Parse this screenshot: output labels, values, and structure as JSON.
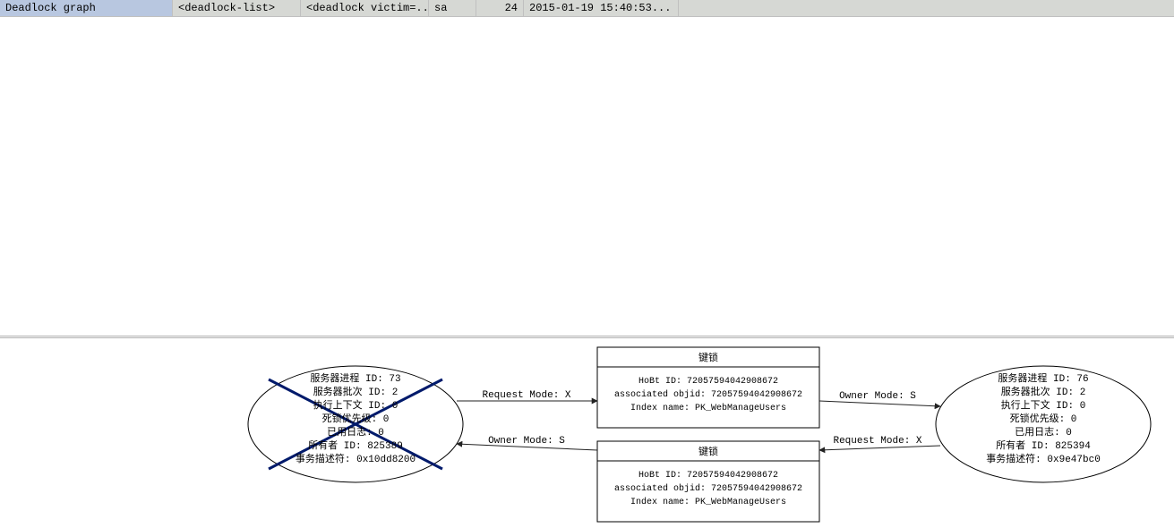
{
  "row": {
    "event_class": "Deadlock graph",
    "textdata": "<deadlock-list>",
    "textdata2": "<deadlock victim=...",
    "login": "sa",
    "spid": "24",
    "starttime": "2015-01-19 15:40:53..."
  },
  "graph": {
    "victim": {
      "lines": [
        "服务器进程 ID: 73",
        "服务器批次 ID: 2",
        "执行上下文 ID: 0",
        "死锁优先级: 0",
        "已用日志: 0",
        "所有者 ID: 825389",
        "事务描述符: 0x10dd8200"
      ]
    },
    "other": {
      "lines": [
        "服务器进程 ID: 76",
        "服务器批次 ID: 2",
        "执行上下文 ID: 0",
        "死锁优先级: 0",
        "已用日志: 0",
        "所有者 ID: 825394",
        "事务描述符: 0x9e47bc0"
      ]
    },
    "resource_top": {
      "title": "键锁",
      "lines": [
        "HoBt ID: 72057594042908672",
        "associated objid: 72057594042908672",
        "Index name: PK_WebManageUsers"
      ]
    },
    "resource_bottom": {
      "title": "键锁",
      "lines": [
        "HoBt ID: 72057594042908672",
        "associated objid: 72057594042908672",
        "Index name: PK_WebManageUsers"
      ]
    },
    "edges": {
      "req_x_left": "Request Mode: X",
      "owner_s_left": "Owner Mode: S",
      "req_x_right": "Request Mode: X",
      "owner_s_right": "Owner Mode: S"
    }
  }
}
